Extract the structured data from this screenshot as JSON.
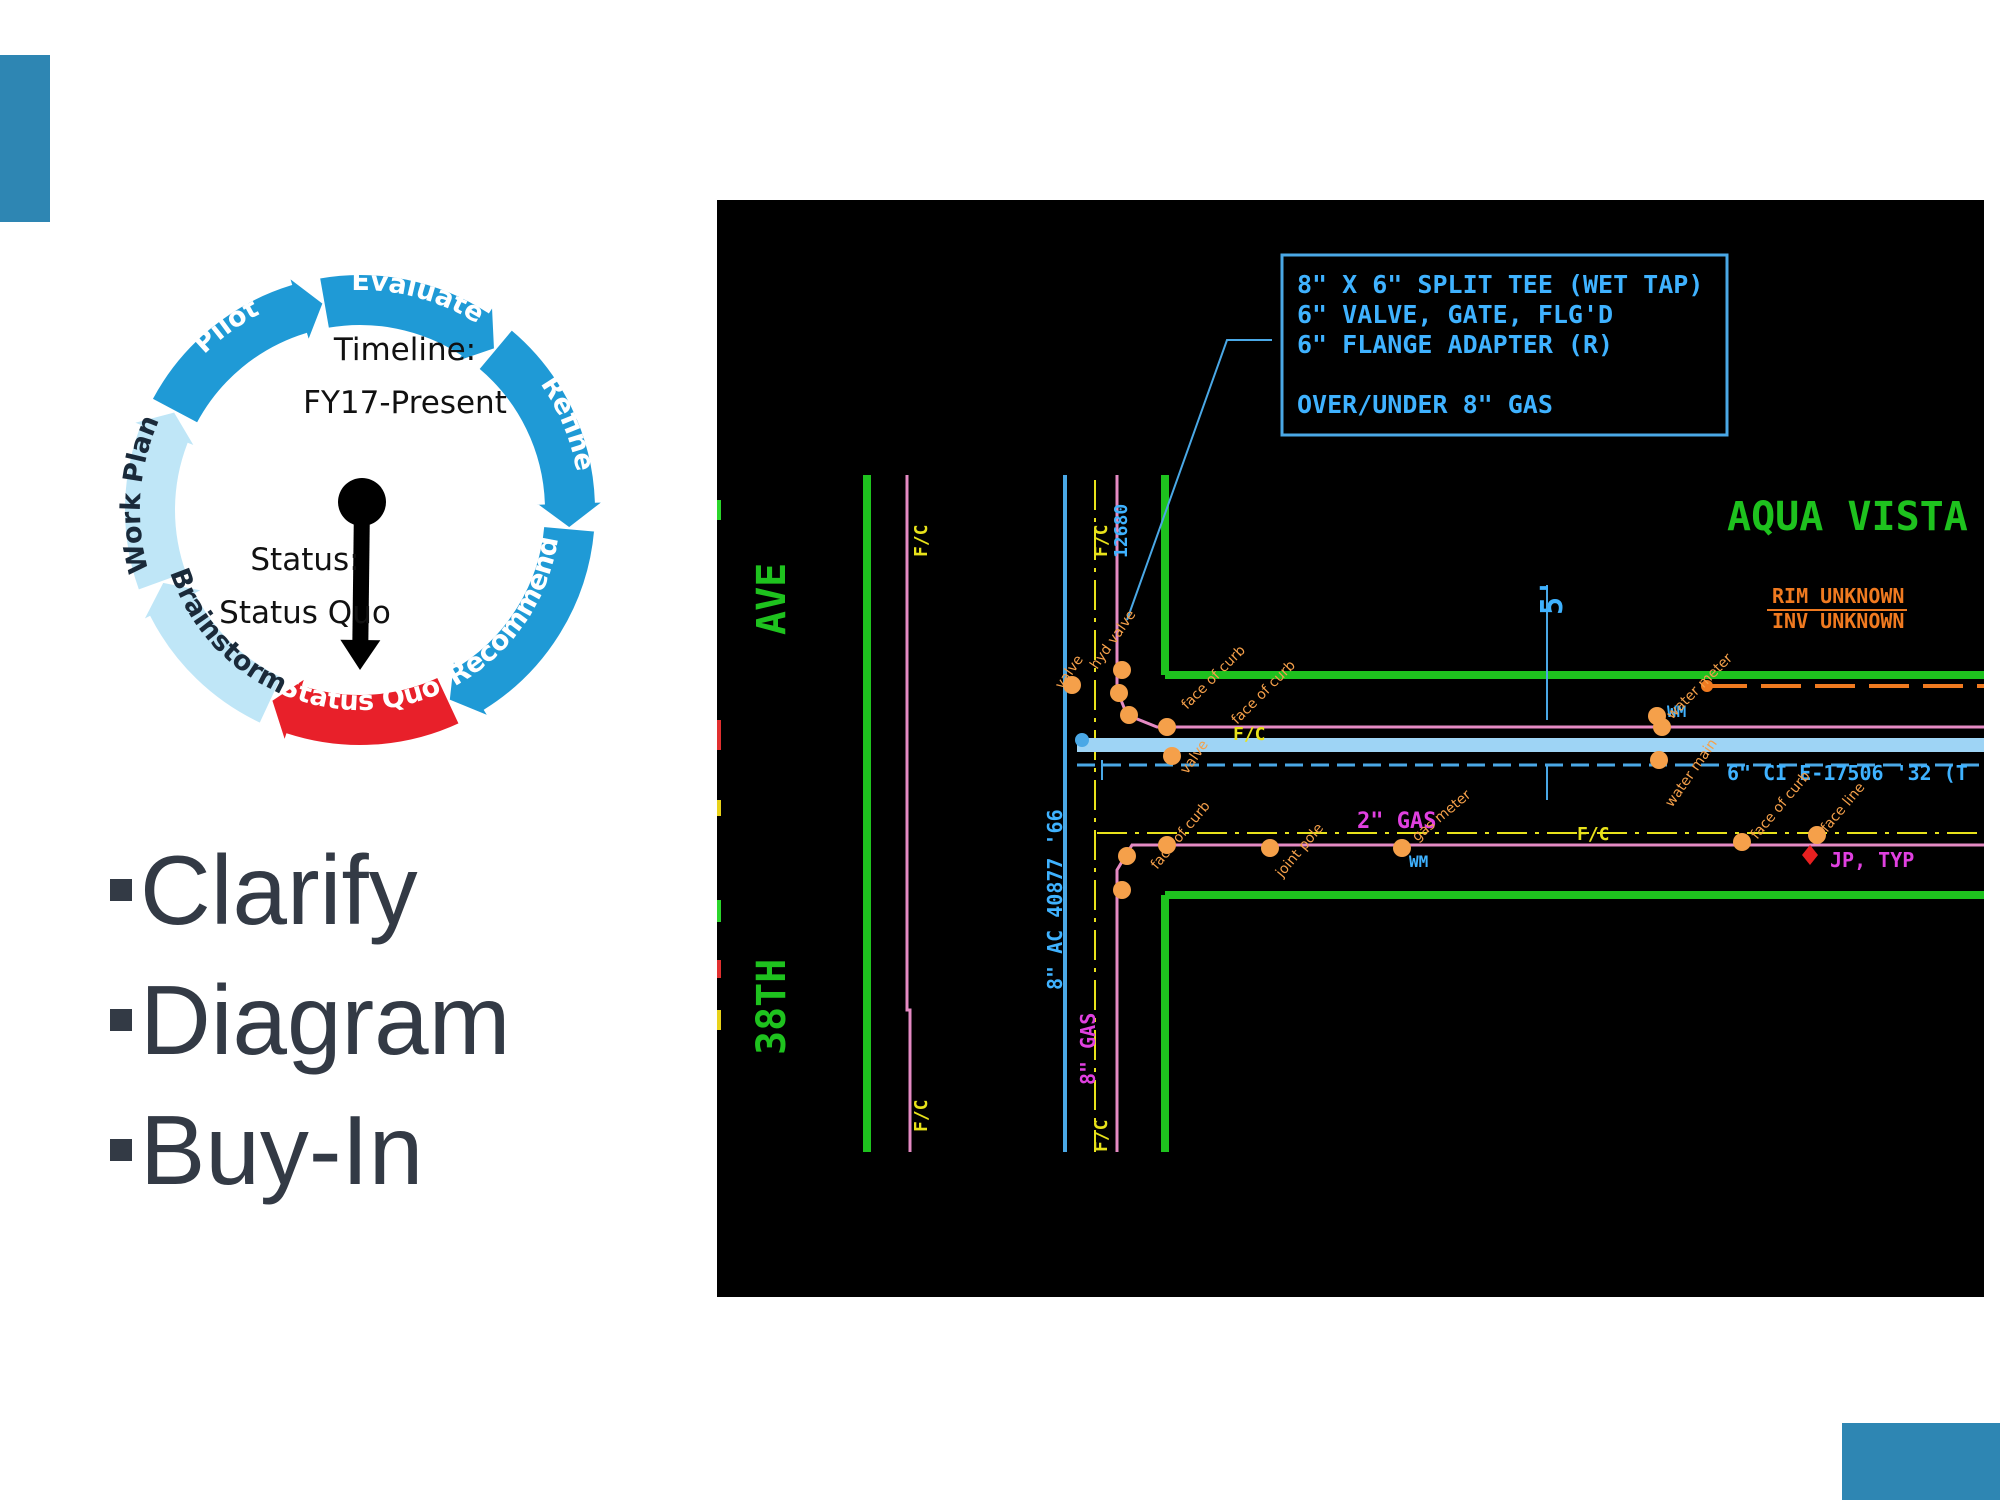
{
  "cycle": {
    "stages": [
      "Status Quo",
      "Brainstorm",
      "Work Plan",
      "Pilot",
      "Evaluate",
      "Refine",
      "Recommend"
    ],
    "timeline_label": "Timeline:",
    "timeline_value": "FY17-Present",
    "status_label": "Status:",
    "status_value": "Status Quo",
    "active_stage": "Status Quo",
    "colors": {
      "active": "#e8202a",
      "ring": "#1f9ad6",
      "light": "#bfe6f7"
    }
  },
  "bullets": [
    "Clarify",
    "Diagram",
    "Buy-In"
  ],
  "cad": {
    "callout_lines": [
      "8\" X 6\" SPLIT TEE (WET TAP)",
      "6\" VALVE, GATE, FLG'D",
      "6\" FLANGE ADAPTER (R)",
      "OVER/UNDER 8\" GAS"
    ],
    "street_left_top": "AVE",
    "street_left_bottom": "38TH",
    "street_right": "AQUA VISTA",
    "dimension": "5'",
    "rim_note": "RIM UNKNOWN",
    "inv_note": "INV UNKNOWN",
    "gas_label": "2\" GAS",
    "gas_vertical": "8\" GAS",
    "ac_main": "8\" AC 40877 '66",
    "ci_main": "6\" CI E-17506 '32 (T",
    "fc": "F/C",
    "jp_note": "JP, TYP",
    "wm": "WM",
    "pipe_id": "12680",
    "points": [
      "face of curb",
      "valve",
      "hyd valve",
      "water meter",
      "water main",
      "joint pole",
      "gas meter",
      "face line"
    ]
  }
}
